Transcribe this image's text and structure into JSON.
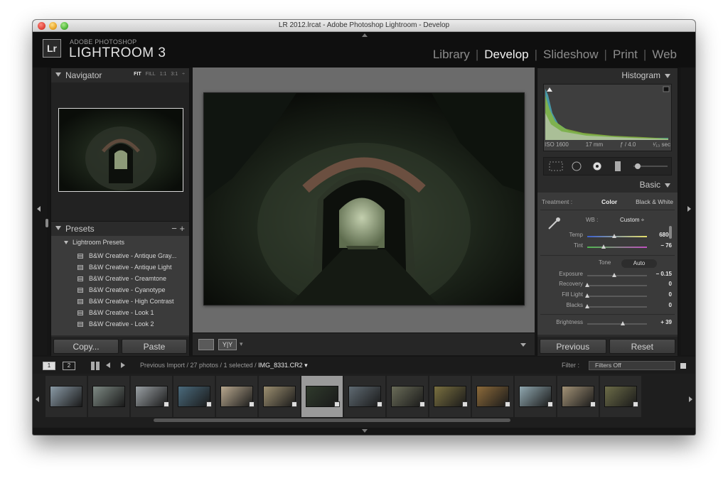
{
  "window": {
    "title": "LR 2012.lrcat - Adobe Photoshop Lightroom - Develop"
  },
  "brand": {
    "small": "ADOBE PHOTOSHOP",
    "big": "LIGHTROOM 3",
    "badge": "Lr"
  },
  "modules": [
    {
      "label": "Library"
    },
    {
      "label": "Develop"
    },
    {
      "label": "Slideshow"
    },
    {
      "label": "Print"
    },
    {
      "label": "Web"
    }
  ],
  "navigator": {
    "label": "Navigator",
    "zoom": [
      "FIT",
      "FILL",
      "1:1",
      "3:1"
    ]
  },
  "presets": {
    "label": "Presets",
    "controls": "− +",
    "folder": "Lightroom Presets",
    "items": [
      "B&W Creative - Antique Gray...",
      "B&W Creative - Antique Light",
      "B&W Creative - Creamtone",
      "B&W Creative - Cyanotype",
      "B&W Creative - High Contrast",
      "B&W Creative - Look 1",
      "B&W Creative - Look 2"
    ]
  },
  "left_buttons": {
    "copy": "Copy...",
    "paste": "Paste"
  },
  "histogram": {
    "label": "Histogram",
    "iso": "ISO 1600",
    "focal": "17 mm",
    "aperture": "ƒ / 4.0",
    "shutter": "¹⁄₁₃ sec"
  },
  "basic": {
    "label": "Basic",
    "treatment_label": "Treatment :",
    "color": "Color",
    "bw": "Black & White",
    "wb_label": "WB :",
    "wb_value": "Custom ÷",
    "temp": {
      "label": "Temp",
      "value": "6800",
      "knob": 0.45
    },
    "tint": {
      "label": "Tint",
      "value": "− 76",
      "knob": 0.27
    },
    "tone_label": "Tone",
    "auto": "Auto",
    "exposure": {
      "label": "Exposure",
      "value": "− 0.15",
      "knob": 0.45
    },
    "recovery": {
      "label": "Recovery",
      "value": "0",
      "knob": 0.0
    },
    "fill_light": {
      "label": "Fill Light",
      "value": "0",
      "knob": 0.0
    },
    "blacks": {
      "label": "Blacks",
      "value": "0",
      "knob": 0.0
    },
    "brightness": {
      "label": "Brightness",
      "value": "+ 39",
      "knob": 0.6
    }
  },
  "right_buttons": {
    "previous": "Previous",
    "reset": "Reset"
  },
  "filmstrip_bar": {
    "screen1": "1",
    "screen2": "2",
    "source": "Previous Import / 27 photos / 1 selected / ",
    "current_file": "IMG_8331.CR2 ▾",
    "filter_label": "Filter :",
    "filter_value": "Filters Off"
  },
  "filmstrip": {
    "selected_index": 6,
    "thumb_colors": [
      "#8a9aa6",
      "#7e8a84",
      "#9aa0a4",
      "#4a6a7c",
      "#b8a88e",
      "#9c8f70",
      "#2f3a2c",
      "#5f6a72",
      "#6a6c58",
      "#7a7040",
      "#8c6a3a",
      "#90a8b0",
      "#a29276",
      "#6c6c48"
    ]
  }
}
